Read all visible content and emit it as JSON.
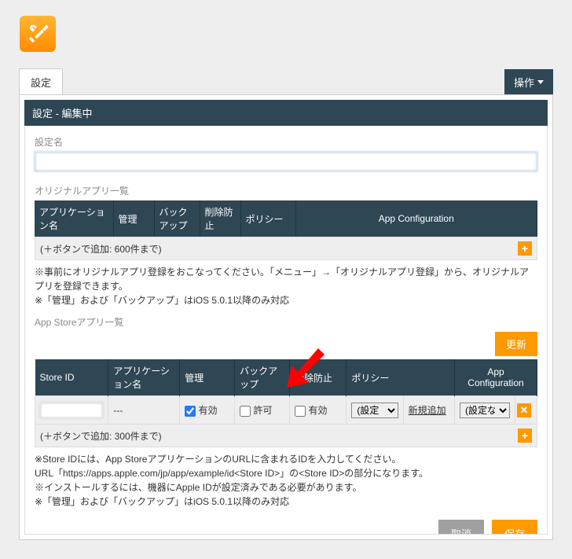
{
  "logoText": "",
  "tabs": {
    "settings": "設定"
  },
  "opsButton": "操作",
  "panelTitle": "設定 - 編集中",
  "nameLabel": "設定名",
  "nameValue": "",
  "origSection": {
    "title": "オリジナルアプリ一覧",
    "headers": {
      "appName": "アプリケーション名",
      "manage": "管理",
      "backup": "バックアップ",
      "prevent": "削除防止",
      "policy": "ポリシー",
      "appconfig": "App Configuration"
    },
    "addHint": "(＋ボタンで追加: 600件まで)",
    "note": "※事前にオリジナルアプリ登録をおこなってください。「メニュー」→「オリジナルアプリ登録」から、オリジナルアプリを登録できます。\n※「管理」および「バックアップ」はiOS 5.0.1以降のみ対応"
  },
  "storeSection": {
    "title": "App Storeアプリ一覧",
    "updateBtn": "更新",
    "headers": {
      "storeId": "Store ID",
      "appName": "アプリケーション名",
      "manage": "管理",
      "backup": "バックアップ",
      "prevent": "削除防止",
      "policy": "ポリシー",
      "appconfig": "App Configuration"
    },
    "row": {
      "storeIdValue": "",
      "appNameValue": "---",
      "manageChecked": true,
      "manageLabel": "有効",
      "backupChecked": false,
      "backupLabel": "許可",
      "preventChecked": false,
      "preventLabel": "有効",
      "policySelect": "(設定",
      "addNewLink": "新規追加",
      "configSelect": "(設定な"
    },
    "addHint": "(＋ボタンで追加: 300件まで)",
    "note": "※Store IDには、App StoreアプリケーションのURLに含まれるIDを入力してください。\nURL「https://apps.apple.com/jp/app/example/id<Store ID>」の<Store ID>の部分になります。\n※インストールするには、機器にApple IDが設定済みである必要があります。\n※「管理」および「バックアップ」はiOS 5.0.1以降のみ対応"
  },
  "footer": {
    "cancel": "取消",
    "save": "保存"
  }
}
